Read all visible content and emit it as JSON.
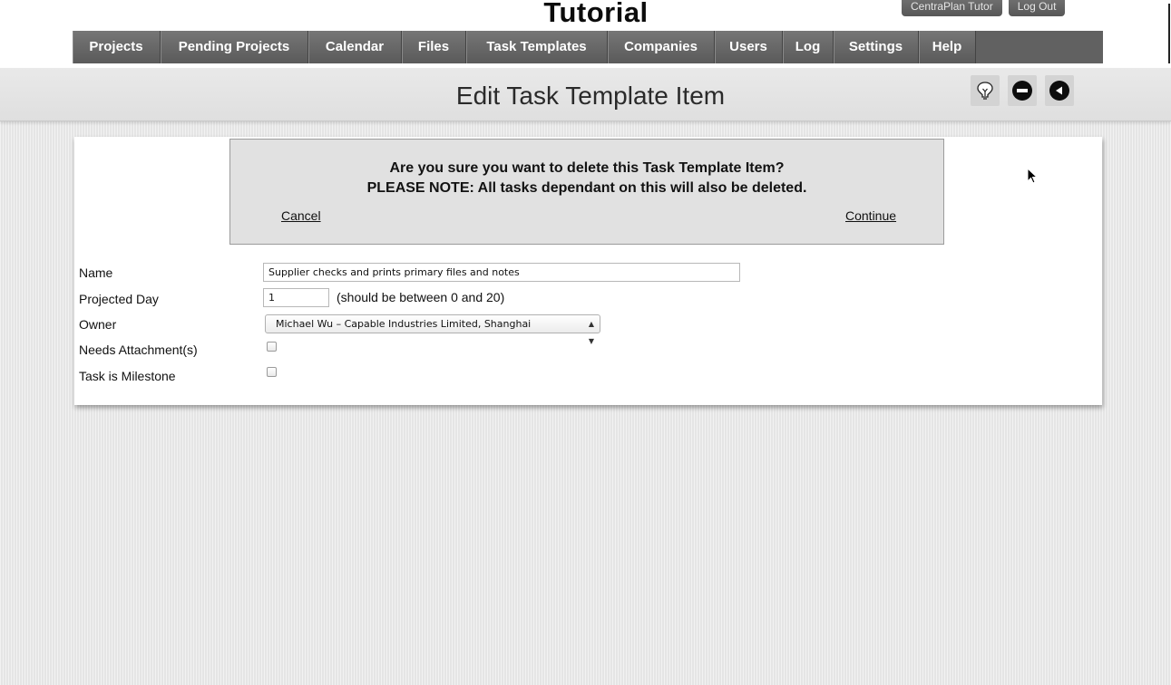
{
  "app": {
    "title": "Tutorial"
  },
  "account": {
    "user_button": "CentraPlan Tutor",
    "logout_button": "Log Out"
  },
  "nav": {
    "items": [
      "Projects",
      "Pending Projects",
      "Calendar",
      "Files",
      "Task Templates",
      "Companies",
      "Users",
      "Log",
      "Settings",
      "Help"
    ]
  },
  "header": {
    "title": "Edit Task Template Item",
    "icons": [
      "lightbulb-icon",
      "minus-circle-icon",
      "back-circle-icon"
    ]
  },
  "confirm": {
    "question": "Are you sure you want to delete this Task Template Item?",
    "note": "PLEASE NOTE: All tasks dependant on this will also be deleted.",
    "cancel_label": "Cancel",
    "continue_label": "Continue"
  },
  "form": {
    "name_label": "Name",
    "name_value": "Supplier checks and prints primary files and notes",
    "projected_day_label": "Projected Day",
    "projected_day_value": "1",
    "projected_day_hint": "(should be between 0 and 20)",
    "owner_label": "Owner",
    "owner_value": "Michael Wu – Capable Industries Limited, Shanghai",
    "needs_attachments_label": "Needs Attachment(s)",
    "needs_attachments_checked": false,
    "milestone_label": "Task is Milestone",
    "milestone_checked": false
  },
  "colors": {
    "nav_bg": "#616161",
    "panel_bg": "#ffffff",
    "confirm_bg": "#e1e1e1"
  }
}
